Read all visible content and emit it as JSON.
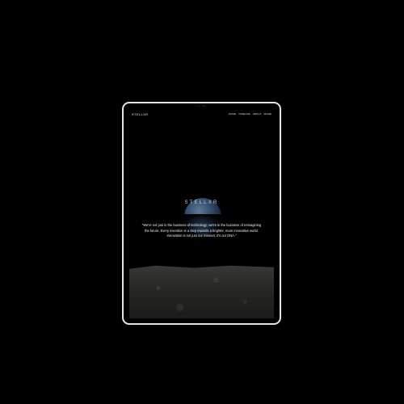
{
  "header": {
    "logo": "STELLXR",
    "nav": [
      "HOME",
      "TIMELINE",
      "ABOUT",
      "MORE"
    ]
  },
  "hero": {
    "brand": "STELLXR",
    "quote_lines": [
      "\"We're not just in the business of technology; we're in the business of reimagining",
      "the future. Every invention is a step towards a brighter, more innovative world.",
      "Innovation is not just our mission; it's our DNA.\""
    ]
  }
}
